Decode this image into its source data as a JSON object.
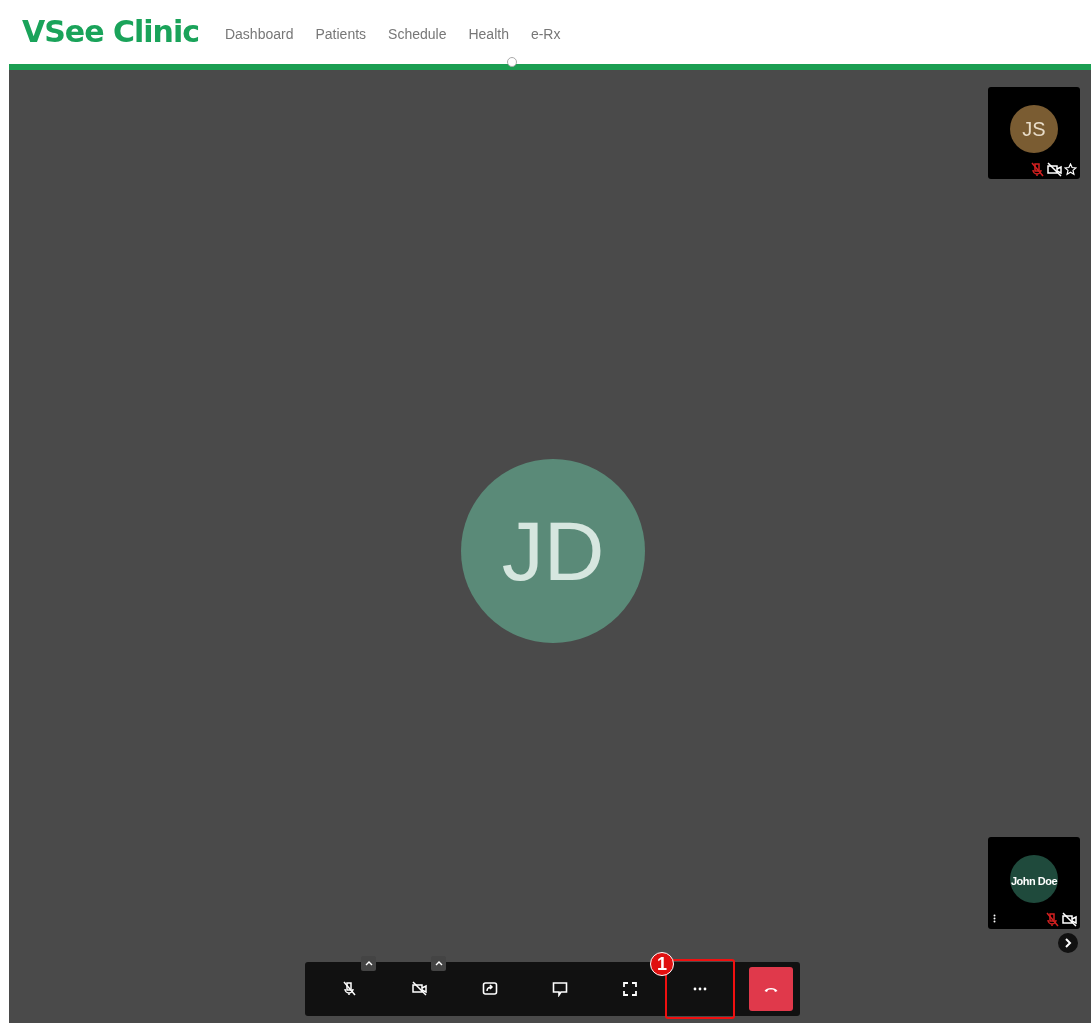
{
  "header": {
    "brand": "VSee Clinic",
    "nav": [
      {
        "label": "Dashboard"
      },
      {
        "label": "Patients"
      },
      {
        "label": "Schedule"
      },
      {
        "label": "Health"
      },
      {
        "label": "e-Rx"
      }
    ]
  },
  "main_participant": {
    "initials": "JD",
    "color": "#5a8a78"
  },
  "tiles": [
    {
      "initials": "JS",
      "color": "#7a5c32",
      "mic_muted": true,
      "camera_off": true,
      "starred": false,
      "has_menu": false
    },
    {
      "color": "#1f4a3c",
      "name": "John Doe",
      "mic_muted": true,
      "camera_off": true,
      "has_menu": true
    }
  ],
  "toolbar": {
    "buttons": [
      {
        "kind": "mic",
        "off": true,
        "highlighted": false
      },
      {
        "kind": "camera",
        "off": true,
        "highlighted": false
      },
      {
        "kind": "share",
        "highlighted": false
      },
      {
        "kind": "chat",
        "highlighted": false
      },
      {
        "kind": "fullscreen",
        "highlighted": false
      },
      {
        "kind": "more",
        "highlighted": true
      },
      {
        "kind": "hangup",
        "highlighted": false
      }
    ],
    "callout": "1"
  }
}
